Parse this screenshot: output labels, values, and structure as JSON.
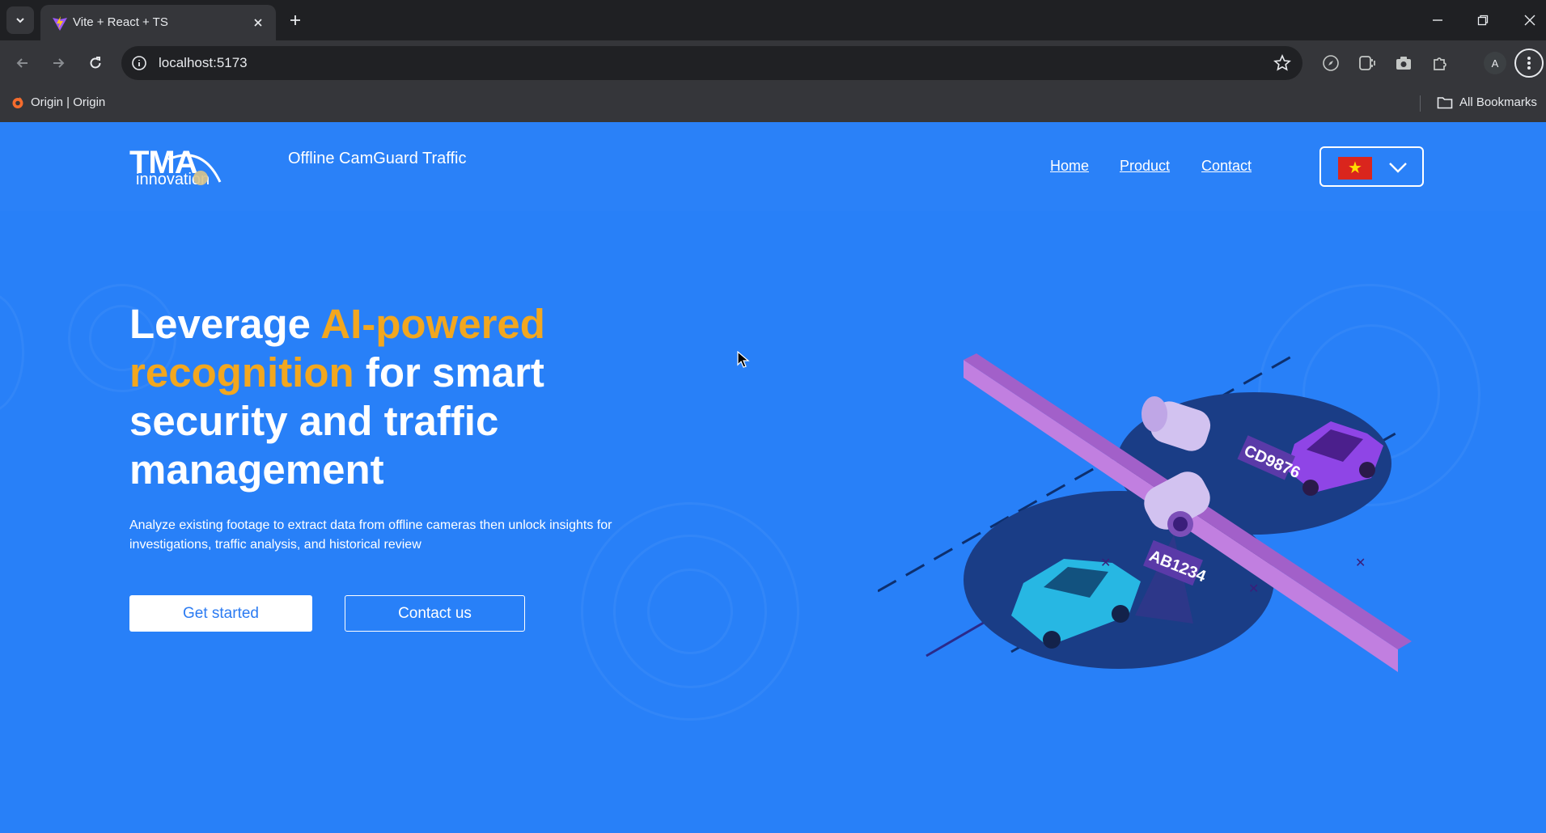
{
  "browser": {
    "tab": {
      "title": "Vite + React + TS"
    },
    "address": {
      "url": "localhost:5173"
    },
    "profile": {
      "initial": "A"
    },
    "bookmarks": {
      "items": [
        {
          "label": "Origin | Origin"
        }
      ],
      "all_label": "All Bookmarks"
    }
  },
  "site": {
    "logo": {
      "wordmark": "TMA",
      "tagline": "innovation"
    },
    "title": "Offline CamGuard Traffic",
    "nav": [
      {
        "label": "Home"
      },
      {
        "label": "Product"
      },
      {
        "label": "Contact"
      }
    ],
    "language": {
      "selected": "vi",
      "flag": "vietnam-flag-icon"
    }
  },
  "hero": {
    "title": {
      "part1": "Leverage ",
      "highlight": "AI-powered recognition",
      "part2": " for smart security and traffic management"
    },
    "description": "Analyze existing footage to extract data from offline cameras then unlock insights for investigations, traffic analysis, and historical review",
    "buttons": {
      "primary": "Get started",
      "secondary": "Contact us"
    }
  },
  "illustration": {
    "plates": [
      "CD9876",
      "AB1234"
    ]
  },
  "colors": {
    "page_bg": "#2880f8",
    "accent": "#f2a71f",
    "chrome_dark": "#1f2023",
    "chrome": "#35363a"
  }
}
